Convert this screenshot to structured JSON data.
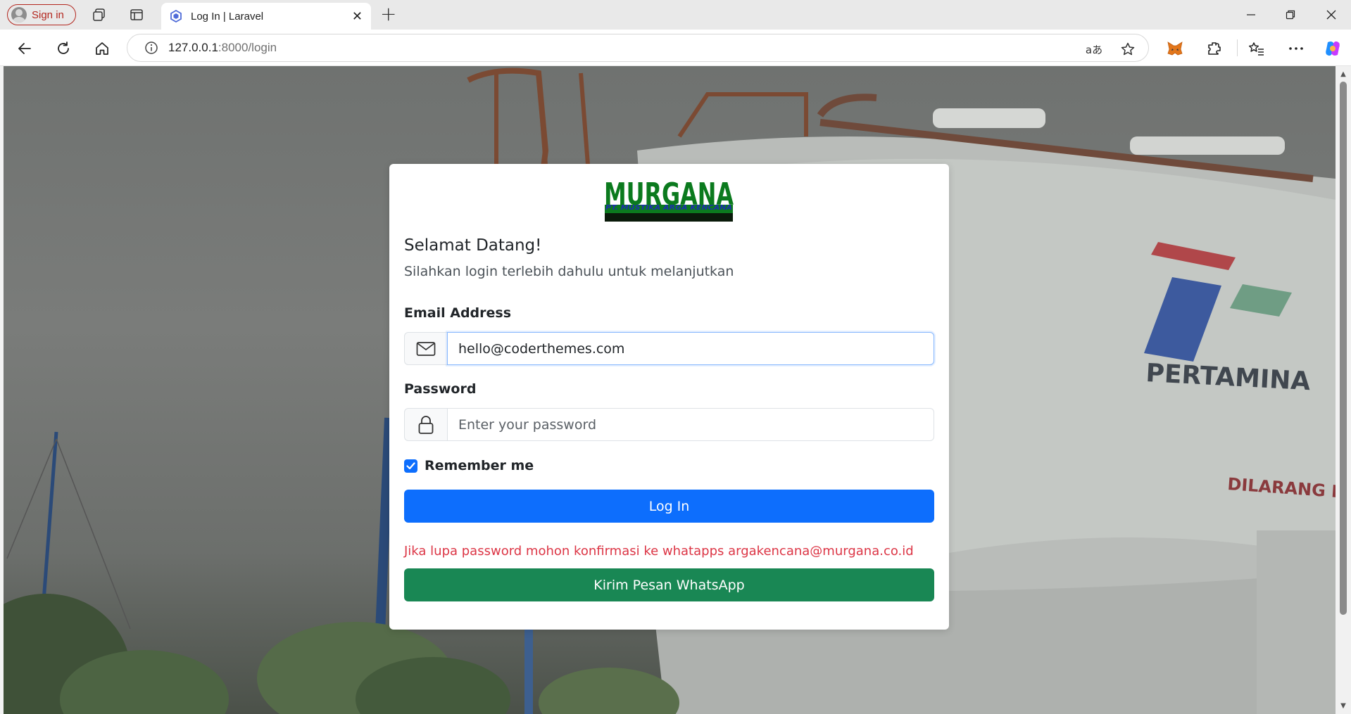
{
  "browser": {
    "profile_label": "Sign in",
    "tab_title": "Log In | Laravel",
    "url_host": "127.0.0.1",
    "url_path": ":8000/login",
    "translate_glyph": "aあ"
  },
  "page": {
    "logo": {
      "brand": "MURGANA",
      "tagline": "PT. MUSTIKA ARGA KENCANA"
    },
    "background": {
      "tank_brand": "PERTAMINA",
      "tank_warning": "DILARANG ME"
    },
    "title": "Selamat Datang!",
    "subtitle": "Silahkan login terlebih dahulu untuk melanjutkan",
    "email": {
      "label": "Email Address",
      "value": "hello@coderthemes.com"
    },
    "password": {
      "label": "Password",
      "placeholder": "Enter your password"
    },
    "remember": {
      "label": "Remember me",
      "checked": true
    },
    "login_button": "Log In",
    "forgot_notice": "Jika lupa password mohon konfirmasi ke whatapps argakencana@murgana.co.id",
    "whatsapp_button": "Kirim Pesan WhatsApp"
  },
  "colors": {
    "primary": "#0d6efd",
    "success": "#198754",
    "danger": "#dc3545",
    "logo_green": "#0b7a1e"
  }
}
